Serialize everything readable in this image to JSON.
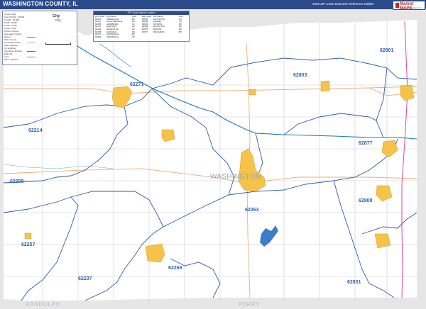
{
  "header": {
    "title": "WASHINGTON COUNTY, IL",
    "subtitle": "2025 ZIP Code Business Reference Edition",
    "logo_text": "Market MAPS",
    "logo_sub": "www.marketmaps.com"
  },
  "legend": {
    "city_label": "City",
    "city_sub": "City",
    "rows": [
      "County Seat",
      "Over 50,000 - 99,999",
      "10,000 - 49,999",
      "5,000 - 9,999",
      "1,000 - 4,999",
      "Under 1,000",
      "Primary School",
      "Secondary School",
      "Airport",
      "Park / Forest",
      "County Boundary",
      "State Highway",
      "US Highway",
      "Interstate Highway",
      "Railroad",
      "Lake",
      "River / Stream"
    ]
  },
  "zip_table": {
    "header": "ZIP Code Name/Location",
    "columns": [
      "ZIP Code",
      "ZIP Name",
      "Grid"
    ],
    "rows_left": [
      [
        "62214",
        "ADDIEVILLE",
        "B2"
      ],
      [
        "62237",
        "COULTERVILLE",
        "D4"
      ],
      [
        "62255",
        "LENZBURG",
        "C1"
      ],
      [
        "62257",
        "MARISSA",
        "D1"
      ],
      [
        "62263",
        "NASHVILLE",
        "C3"
      ],
      [
        "62268",
        "OAKDALE",
        "D3"
      ],
      [
        "62271",
        "OKAWVILLE",
        "B2"
      ],
      [
        "62801",
        "CENTRALIA",
        "A5"
      ]
    ],
    "rows_right": [
      [
        "62803",
        "HOYLETON",
        "A4"
      ],
      [
        "62808",
        "ASHLEY",
        "C5"
      ],
      [
        "62831",
        "DU BOIS",
        "D5"
      ],
      [
        "62848",
        "IRVINGTON",
        "B5"
      ],
      [
        "62876",
        "RADOM",
        "D5"
      ],
      [
        "62877",
        "RICHVIEW",
        "B5"
      ],
      [
        "",
        "",
        " "
      ],
      [
        "",
        "",
        " "
      ]
    ]
  },
  "map": {
    "county_name": "WASHINGTON",
    "neighbor_south_west": "RANDOLPH",
    "neighbor_south": "PERRY",
    "zip_labels": [
      {
        "zip": "62801"
      },
      {
        "zip": "62803"
      },
      {
        "zip": "62271"
      },
      {
        "zip": "62214"
      },
      {
        "zip": "62877"
      },
      {
        "zip": "62255"
      },
      {
        "zip": "62263"
      },
      {
        "zip": "62808"
      },
      {
        "zip": "62257"
      },
      {
        "zip": "62268"
      },
      {
        "zip": "62237"
      },
      {
        "zip": "62831"
      }
    ],
    "colors": {
      "zip_boundary": "#2f5aa8",
      "town_fill": "#f5c24a",
      "river": "#1f78b4",
      "water": "#3d7cc9",
      "state_hwy": "#e8a86a",
      "us_hwy": "#d94a9a",
      "outside": "#e3e3e3",
      "road": "#c7cbd2"
    }
  }
}
